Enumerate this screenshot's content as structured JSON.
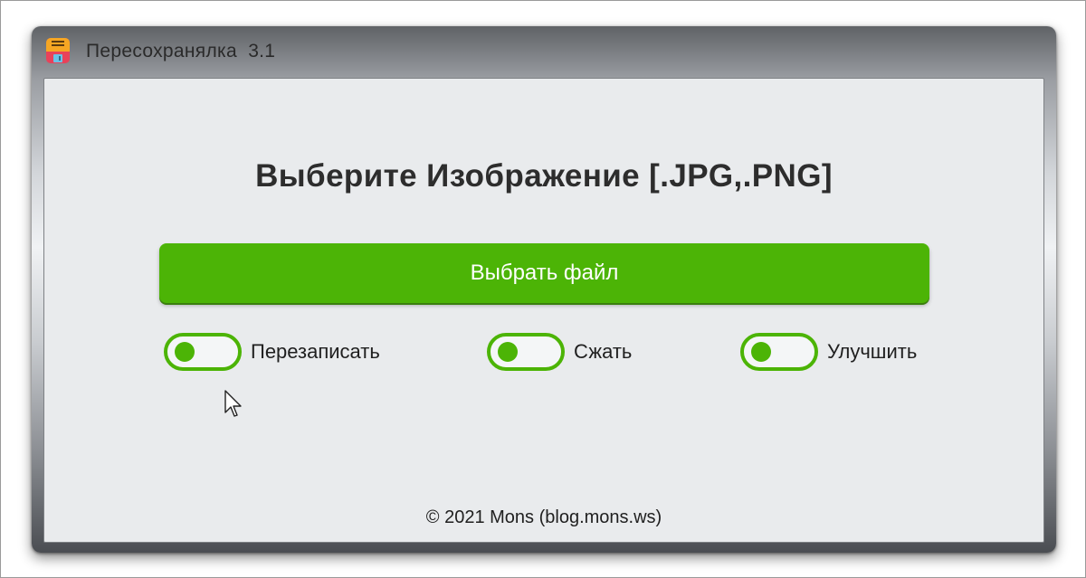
{
  "window": {
    "title": "Пересохранялка  3.1",
    "icon": "floppy-disk-icon"
  },
  "main": {
    "heading": "Выберите Изображение [.JPG,.PNG]",
    "choose_button_label": "Выбрать файл",
    "toggles": [
      {
        "label": "Перезаписать",
        "state": "off"
      },
      {
        "label": "Сжать",
        "state": "off"
      },
      {
        "label": "Улучшить",
        "state": "off"
      }
    ],
    "footer": "© 2021 Mons (blog.mons.ws)"
  },
  "colors": {
    "accent": "#4cb406",
    "client_bg": "#e9ebed"
  }
}
